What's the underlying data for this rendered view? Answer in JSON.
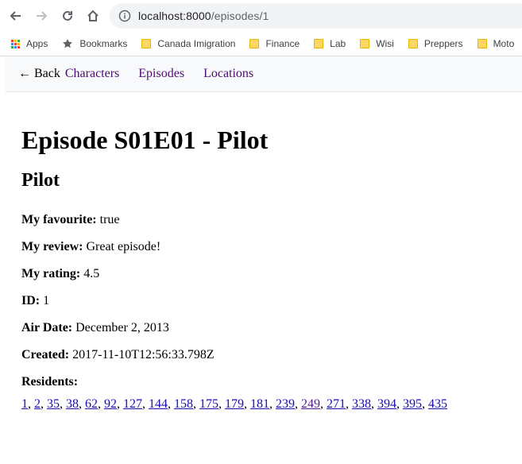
{
  "browser": {
    "url_host": "localhost:8000",
    "url_path": "/episodes/1",
    "bookmarks": [
      {
        "label": "Apps",
        "icon": "apps-grid-icon"
      },
      {
        "label": "Bookmarks",
        "icon": "star-icon"
      },
      {
        "label": "Canada Imigration",
        "icon": "folder-icon"
      },
      {
        "label": "Finance",
        "icon": "folder-icon"
      },
      {
        "label": "Lab",
        "icon": "folder-icon"
      },
      {
        "label": "Wisi",
        "icon": "folder-icon"
      },
      {
        "label": "Preppers",
        "icon": "folder-icon"
      },
      {
        "label": "Moto",
        "icon": "folder-icon"
      }
    ]
  },
  "nav": {
    "back_label": "← Back",
    "links": [
      "Characters",
      "Episodes",
      "Locations"
    ],
    "link_color": "#4b0c6e"
  },
  "episode": {
    "heading": "Episode S01E01 - Pilot",
    "name": "Pilot",
    "fields": [
      {
        "label": "My favourite:",
        "value": "true"
      },
      {
        "label": "My review:",
        "value": "Great episode!"
      },
      {
        "label": "My rating:",
        "value": "4.5"
      },
      {
        "label": "ID:",
        "value": "1"
      },
      {
        "label": "Air Date:",
        "value": "December 2, 2013"
      },
      {
        "label": "Created:",
        "value": "2017-11-10T12:56:33.798Z"
      }
    ],
    "residents_label": "Residents:",
    "residents": [
      "1",
      "2",
      "35",
      "38",
      "62",
      "92",
      "127",
      "144",
      "158",
      "175",
      "179",
      "181",
      "239",
      "249",
      "271",
      "338",
      "394",
      "395",
      "435"
    ]
  }
}
